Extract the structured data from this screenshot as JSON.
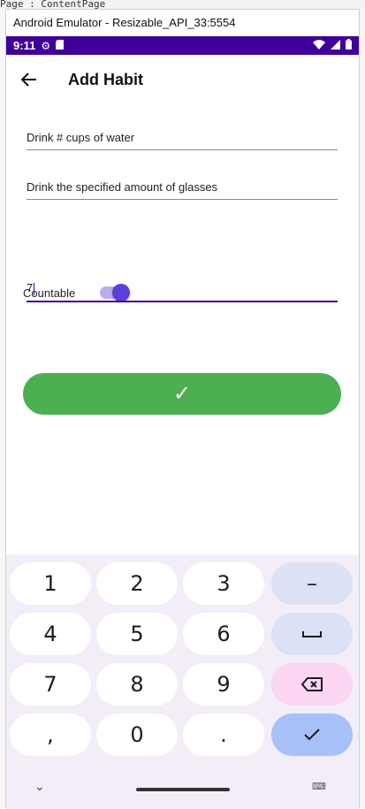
{
  "ide": {
    "top_text": "Page : ContentPage"
  },
  "window": {
    "title": "Android Emulator - Resizable_API_33:5554"
  },
  "status_bar": {
    "time": "9:11"
  },
  "app": {
    "title": "Add Habit",
    "fields": {
      "name_value": "Drink # cups of water",
      "description_value": "Drink the specified amount of glasses",
      "count_value": "7"
    },
    "countable": {
      "label": "Countable",
      "on": true
    },
    "save_label": "✓"
  },
  "keyboard": {
    "rows": [
      [
        "1",
        "2",
        "3",
        "–"
      ],
      [
        "4",
        "5",
        "6",
        "␣"
      ],
      [
        "7",
        "8",
        "9",
        "⌫"
      ],
      [
        ",",
        "0",
        ".",
        "✓"
      ]
    ]
  },
  "colors": {
    "accent": "#3f0099",
    "save": "#4caf50",
    "switch_thumb": "#5c3fd8"
  }
}
